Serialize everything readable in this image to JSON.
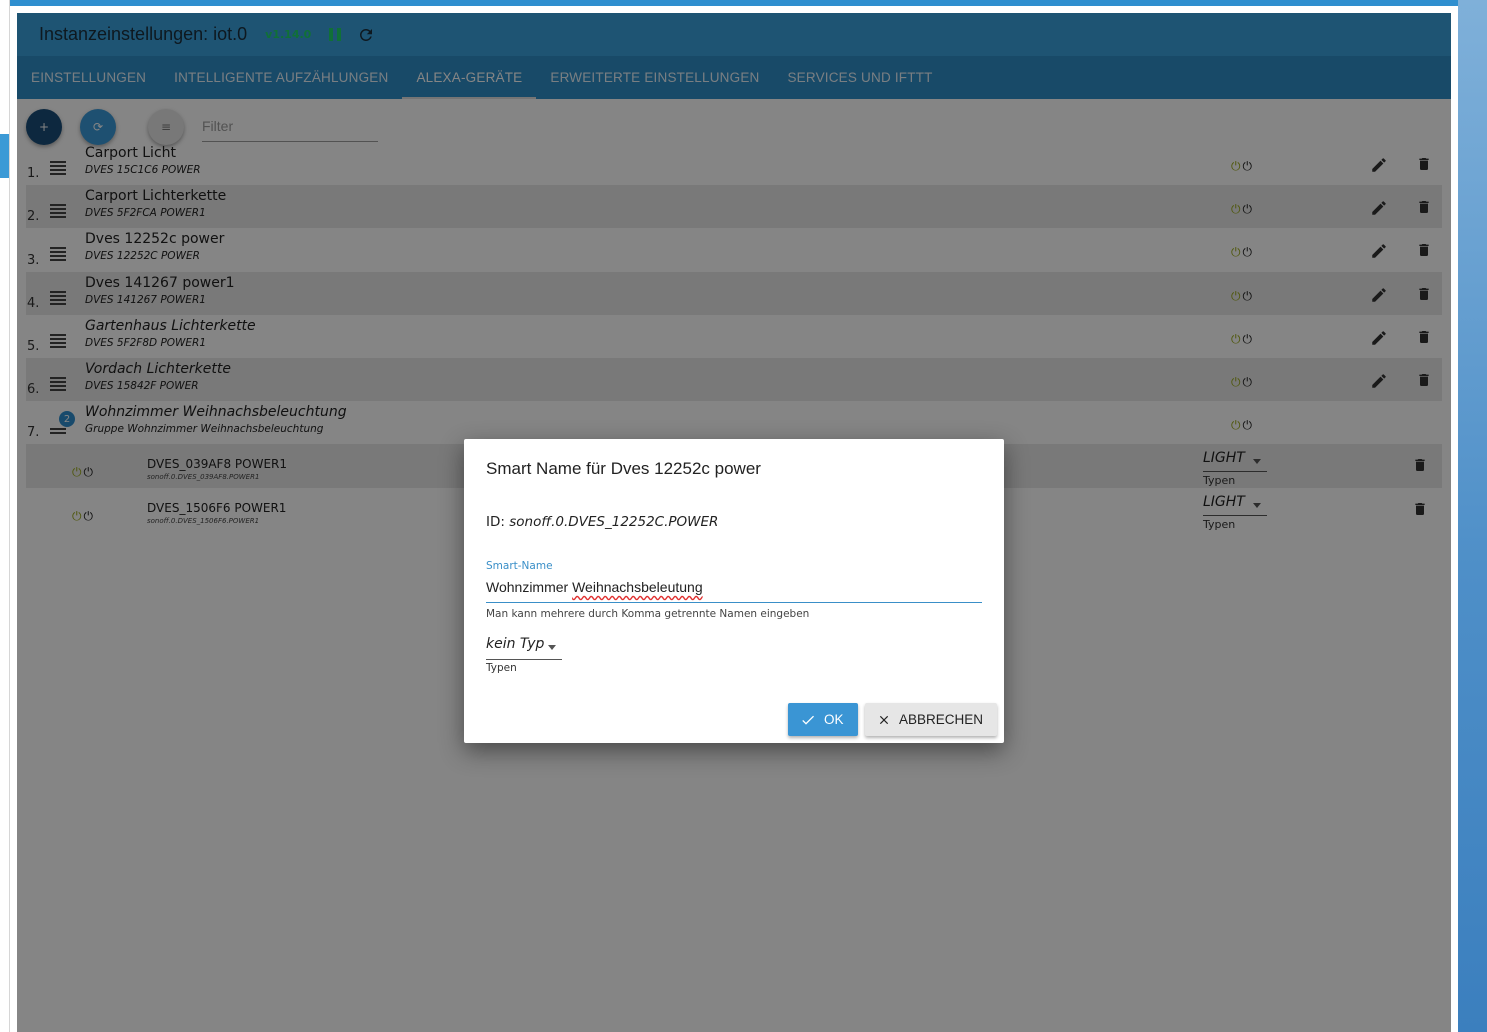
{
  "header": {
    "title": "Instanzeinstellungen: iot.0",
    "version": "v1.14.0"
  },
  "tabs": [
    {
      "label": "EINSTELLUNGEN"
    },
    {
      "label": "INTELLIGENTE AUFZÄHLUNGEN"
    },
    {
      "label": "ALEXA-GERÄTE"
    },
    {
      "label": "ERWEITERTE EINSTELLUNGEN"
    },
    {
      "label": "SERVICES UND IFTTT"
    }
  ],
  "toolbar": {
    "add_label": "+",
    "refresh_label": "⟳",
    "list_label": "≡",
    "filter_placeholder": "Filter"
  },
  "devices": [
    {
      "num": "1.",
      "name": "Carport Licht",
      "id": "DVES 15C1C6 POWER"
    },
    {
      "num": "2.",
      "name": "Carport Lichterkette",
      "id": "DVES 5F2FCA POWER1"
    },
    {
      "num": "3.",
      "name": "Dves 12252c power",
      "id": "DVES 12252C POWER"
    },
    {
      "num": "4.",
      "name": "Dves 141267 power1",
      "id": "DVES 141267 POWER1"
    },
    {
      "num": "5.",
      "name": "Gartenhaus Lichterkette",
      "id": "DVES 5F2F8D POWER1"
    },
    {
      "num": "6.",
      "name": "Vordach Lichterkette",
      "id": "DVES 15842F POWER"
    }
  ],
  "group": {
    "num": "7.",
    "badge": "2",
    "name": "Wohnzimmer Weihnachsbeleuchtung",
    "id": "Gruppe Wohnzimmer Weihnachsbeleuchtung",
    "members": [
      {
        "title": "DVES_039AF8 POWER1",
        "id": "sonoff.0.DVES_039AF8.POWER1",
        "type": "LIGHT",
        "type_help": "Typen"
      },
      {
        "title": "DVES_1506F6 POWER1",
        "id": "sonoff.0.DVES_1506F6.POWER1",
        "type": "LIGHT",
        "type_help": "Typen"
      }
    ]
  },
  "dialog": {
    "title": "Smart Name für Dves 12252c power",
    "id_label": "ID:",
    "id_value": "sonoff.0.DVES_12252C.POWER",
    "smartname_label": "Smart-Name",
    "smartname_word1": "Wohnzimmer",
    "smartname_word2": "Weihnachsbeleutung",
    "smartname_help": "Man kann mehrere durch Komma getrennte Namen eingeben",
    "type_value": "kein Typ",
    "type_help": "Typen",
    "ok_label": "OK",
    "cancel_label": "ABBRECHEN"
  },
  "colors": {
    "header": "#3aa2dc",
    "tabs": "#2f8fc7",
    "accent": "#3a95d4",
    "power_on": "#9aaa1b"
  }
}
